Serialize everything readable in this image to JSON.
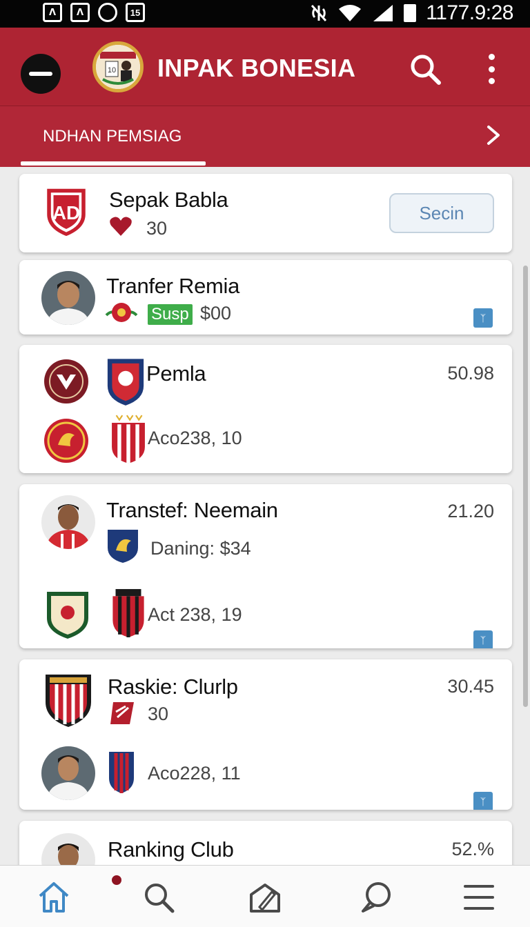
{
  "status_bar": {
    "icons": [
      "dash-icon",
      "gallery-icon",
      "alarm-icon",
      "calendar-icon"
    ],
    "icon_labels": [
      "ᐱ",
      "ᐱ",
      "",
      "15"
    ],
    "time": "1177.9:28"
  },
  "app_bar": {
    "title": "INPAK BONESIA",
    "logo_text": "10",
    "colors": {
      "primary": "#ae2433",
      "accent": "#d8a83c"
    }
  },
  "tab": {
    "label": "NDHAN PEMSIAG"
  },
  "cards": [
    {
      "title": "Sepak Babla",
      "crest_text": "AD",
      "count": "30",
      "button_label": "Secin"
    },
    {
      "title": "Tranfer Remia",
      "badge": "Susp",
      "amount": "$00"
    },
    {
      "title": "Pemla",
      "value": "50.98",
      "sub": "Aco238, 10"
    },
    {
      "title": "Transtef: Neemain",
      "value": "21.20",
      "sub1": "Daning: $34",
      "sub2": "Act 238, 19"
    },
    {
      "title": "Raskie: Clurlp",
      "value": "30.45",
      "count": "30",
      "sub": "Aco228, 11"
    },
    {
      "title": "Ranking Club",
      "value": "52.%"
    }
  ],
  "bottom_nav": [
    "home-icon",
    "search-icon",
    "edit-icon",
    "chat-icon",
    "menu-icon"
  ]
}
